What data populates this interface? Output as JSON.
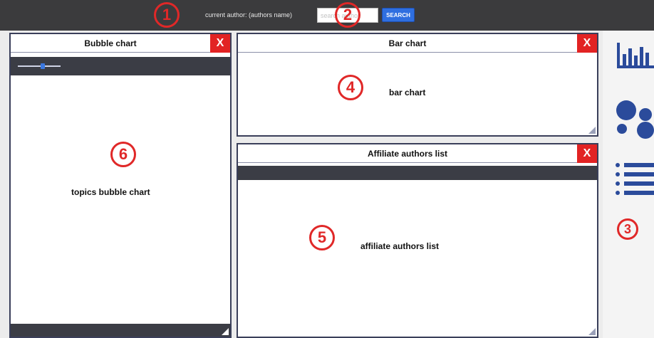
{
  "topbar": {
    "author_text": "current author: (authors name)",
    "search_placeholder": "search author",
    "search_button": "SEARCH"
  },
  "markers": [
    "1",
    "2",
    "3",
    "4",
    "5",
    "6"
  ],
  "panels": {
    "bubble": {
      "title": "Bubble chart",
      "close_label": "X",
      "body_text": "topics bubble chart",
      "slider_value": 0.6
    },
    "bar": {
      "title": "Bar chart",
      "close_label": "X",
      "body_text": "bar chart"
    },
    "affiliate": {
      "title": "Affiliate authors list",
      "close_label": "X",
      "body_text": "affiliate authors list"
    }
  },
  "rightbar": {
    "icons": [
      "bar-chart-icon",
      "bubble-chart-icon",
      "list-icon"
    ]
  },
  "colors": {
    "topbar": "#3b3b3d",
    "accent_button": "#2f6fe0",
    "close_button": "#e22323",
    "marker": "#e02828",
    "icon": "#2b4b9b"
  }
}
